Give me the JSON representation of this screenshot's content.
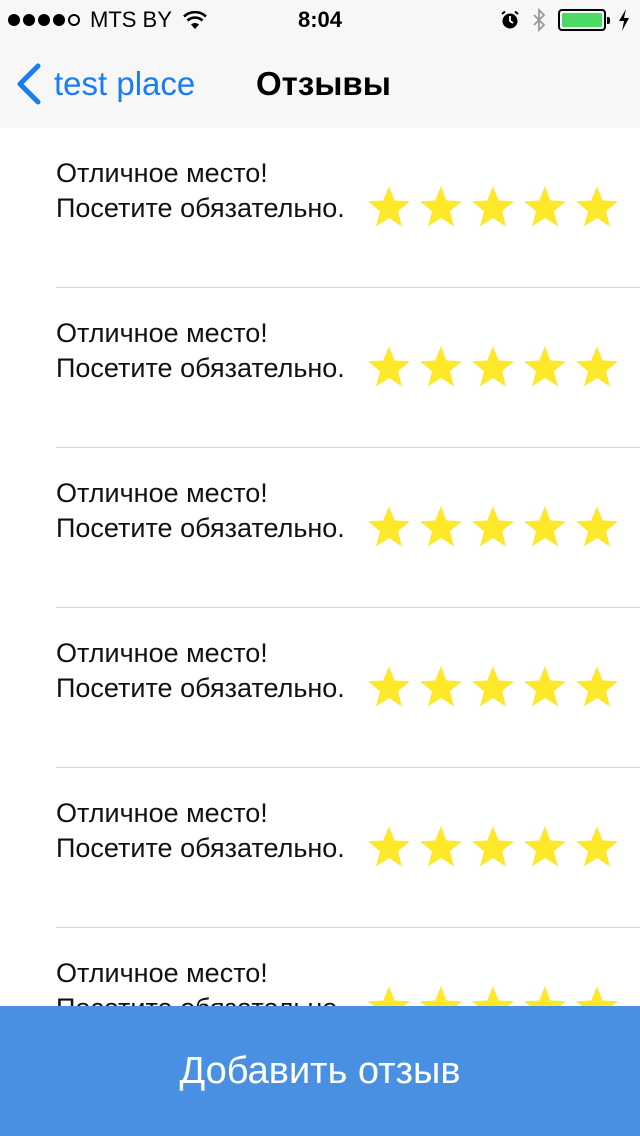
{
  "status_bar": {
    "carrier": "MTS BY",
    "time": "8:04",
    "signal_bars_filled": 4,
    "signal_bars_total": 5,
    "battery_level": 1.0
  },
  "nav": {
    "back_label": "test place",
    "title": "Отзывы",
    "accent_color": "#1a7cf5"
  },
  "reviews": [
    {
      "text": "Отличное место! Посетите обязательно.",
      "rating": 5
    },
    {
      "text": "Отличное место! Посетите обязательно.",
      "rating": 5
    },
    {
      "text": "Отличное место! Посетите обязательно.",
      "rating": 5
    },
    {
      "text": "Отличное место! Посетите обязательно.",
      "rating": 5
    },
    {
      "text": "Отличное место! Посетите обязательно.",
      "rating": 5
    },
    {
      "text": "Отличное место! Посетите обязательно.",
      "rating": 5
    }
  ],
  "star_color": "#fde82a",
  "add_review_button": {
    "label": "Добавить отзыв",
    "color": "#4a90e2"
  }
}
